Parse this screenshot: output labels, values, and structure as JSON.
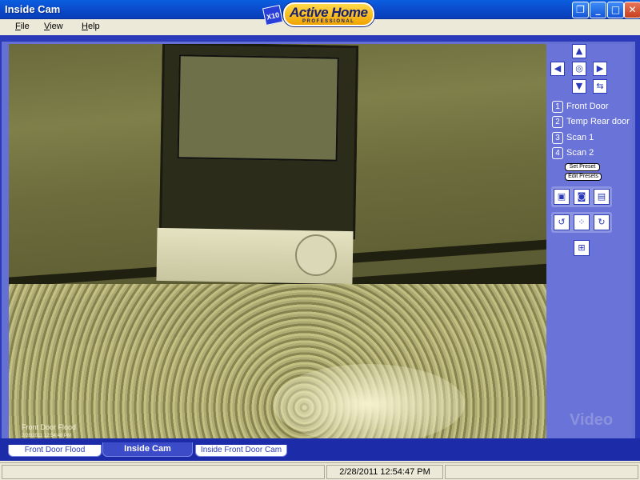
{
  "window": {
    "title": "Inside Cam",
    "controls": [
      "restore-icon",
      "minimize-icon",
      "maximize-icon",
      "close-icon"
    ]
  },
  "brand": {
    "badge": "X10",
    "name": "Active Home",
    "subtitle": "PROFESSIONAL"
  },
  "menu": {
    "file": "File",
    "view": "View",
    "help": "Help"
  },
  "video": {
    "camera_label": "Front Door Flood",
    "overlay_timestamp": "2/28/2011 12:54:48 PM"
  },
  "ptz": {
    "up": "▲",
    "down": "▼",
    "left": "◀",
    "right": "▶",
    "center": "◎",
    "swap": "⇆"
  },
  "presets": [
    {
      "num": "1",
      "label": "Front Door"
    },
    {
      "num": "2",
      "label": "Temp Rear door"
    },
    {
      "num": "3",
      "label": "Scan 1"
    },
    {
      "num": "4",
      "label": "Scan 2"
    }
  ],
  "preset_buttons": {
    "set": "Set Preset",
    "edit": "Edit Presets"
  },
  "tools": {
    "snapshot": "▣",
    "camera": "◙",
    "record": "▤",
    "rotate_left": "↺",
    "grid4": "⁘",
    "rotate_right": "↻",
    "layout": "⊞"
  },
  "watermark": "Video",
  "tabs": [
    {
      "label": "Front Door Flood",
      "active": false
    },
    {
      "label": "Inside Cam",
      "active": true
    },
    {
      "label": "Inside Front Door Cam",
      "active": false
    }
  ],
  "status": {
    "time": "2/28/2011 12:54:47 PM"
  }
}
